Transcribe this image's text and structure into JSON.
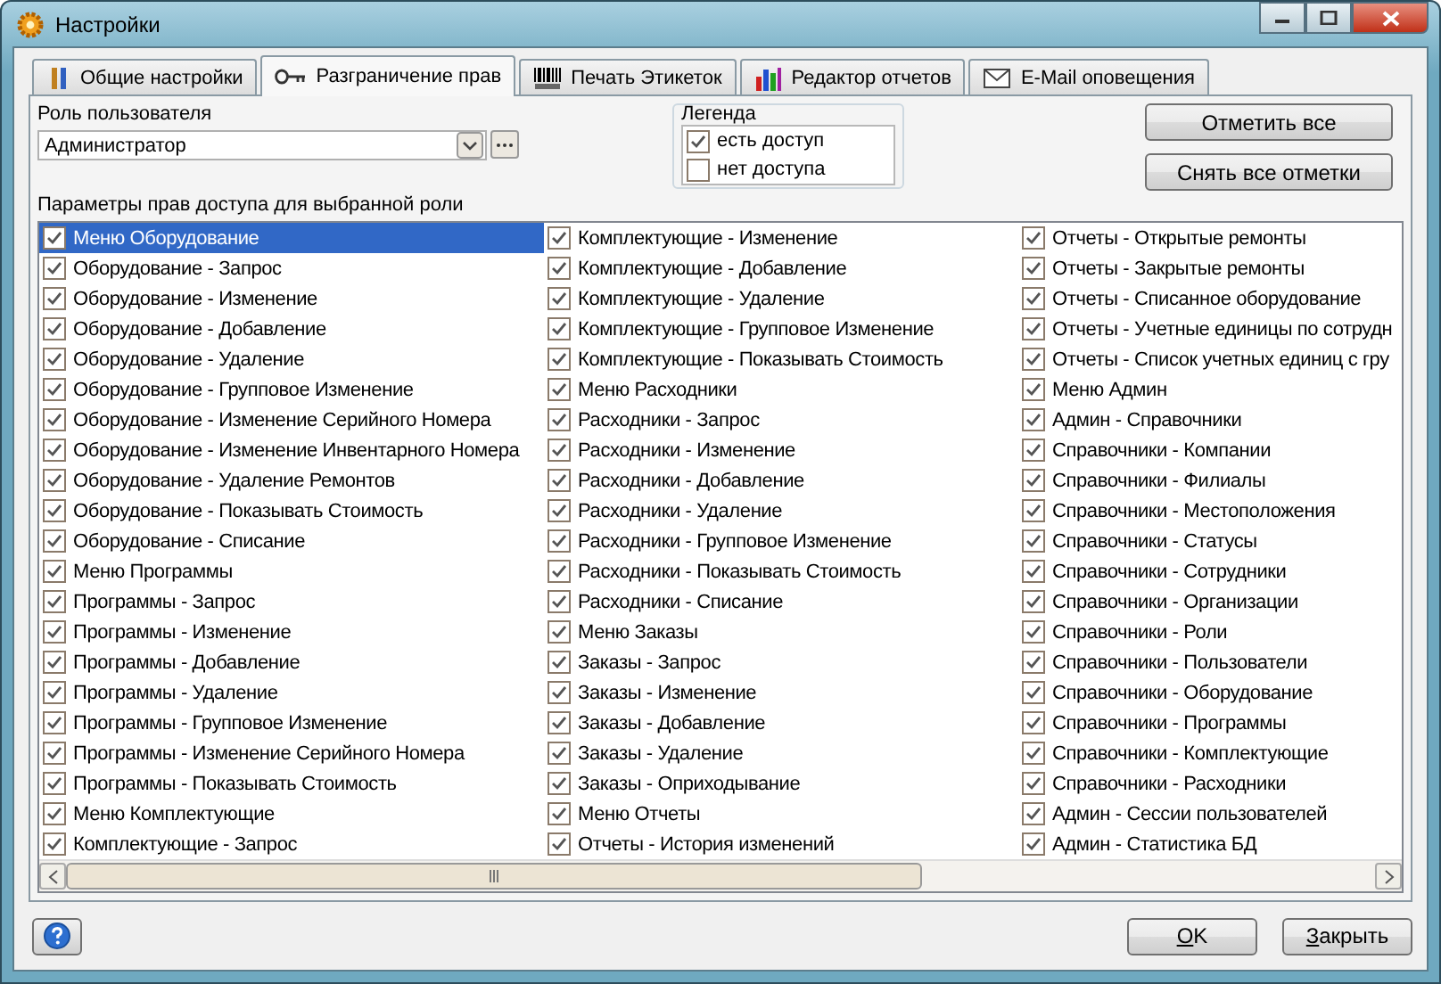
{
  "window": {
    "title": "Настройки"
  },
  "tabs": [
    {
      "label": "Общие настройки",
      "selected": false
    },
    {
      "label": "Разграничение прав",
      "selected": true
    },
    {
      "label": "Печать Этикеток",
      "selected": false
    },
    {
      "label": "Редактор отчетов",
      "selected": false
    },
    {
      "label": "E-Mail оповещения",
      "selected": false
    }
  ],
  "role": {
    "label": "Роль пользователя",
    "value": "Администратор"
  },
  "legend": {
    "title": "Легенда",
    "items": [
      {
        "label": "есть доступ",
        "checked": true
      },
      {
        "label": "нет доступа",
        "checked": false
      }
    ]
  },
  "side_buttons": [
    "Отметить все",
    "Снять все отметки"
  ],
  "permissions": {
    "label": "Параметры прав доступа для выбранной роли",
    "columns": [
      [
        {
          "label": "Меню Оборудование",
          "checked": true,
          "selected": true
        },
        {
          "label": "Оборудование - Запрос",
          "checked": true,
          "selected": false
        },
        {
          "label": "Оборудование - Изменение",
          "checked": true,
          "selected": false
        },
        {
          "label": "Оборудование - Добавление",
          "checked": true,
          "selected": false
        },
        {
          "label": "Оборудование - Удаление",
          "checked": true,
          "selected": false
        },
        {
          "label": "Оборудование - Групповое Изменение",
          "checked": true,
          "selected": false
        },
        {
          "label": "Оборудование - Изменение Серийного Номера",
          "checked": true,
          "selected": false
        },
        {
          "label": "Оборудование - Изменение Инвентарного Номера",
          "checked": true,
          "selected": false
        },
        {
          "label": "Оборудование - Удаление Ремонтов",
          "checked": true,
          "selected": false
        },
        {
          "label": "Оборудование - Показывать Стоимость",
          "checked": true,
          "selected": false
        },
        {
          "label": "Оборудование - Списание",
          "checked": true,
          "selected": false
        },
        {
          "label": "Меню Программы",
          "checked": true,
          "selected": false
        },
        {
          "label": "Программы - Запрос",
          "checked": true,
          "selected": false
        },
        {
          "label": "Программы - Изменение",
          "checked": true,
          "selected": false
        },
        {
          "label": "Программы - Добавление",
          "checked": true,
          "selected": false
        },
        {
          "label": "Программы - Удаление",
          "checked": true,
          "selected": false
        },
        {
          "label": "Программы - Групповое Изменение",
          "checked": true,
          "selected": false
        },
        {
          "label": "Программы - Изменение Серийного Номера",
          "checked": true,
          "selected": false
        },
        {
          "label": "Программы - Показывать Стоимость",
          "checked": true,
          "selected": false
        },
        {
          "label": "Меню Комплектующие",
          "checked": true,
          "selected": false
        },
        {
          "label": "Комплектующие - Запрос",
          "checked": true,
          "selected": false
        }
      ],
      [
        {
          "label": "Комплектующие - Изменение",
          "checked": true,
          "selected": false
        },
        {
          "label": "Комплектующие - Добавление",
          "checked": true,
          "selected": false
        },
        {
          "label": "Комплектующие - Удаление",
          "checked": true,
          "selected": false
        },
        {
          "label": "Комплектующие - Групповое Изменение",
          "checked": true,
          "selected": false
        },
        {
          "label": "Комплектующие - Показывать Стоимость",
          "checked": true,
          "selected": false
        },
        {
          "label": "Меню Расходники",
          "checked": true,
          "selected": false
        },
        {
          "label": "Расходники - Запрос",
          "checked": true,
          "selected": false
        },
        {
          "label": "Расходники - Изменение",
          "checked": true,
          "selected": false
        },
        {
          "label": "Расходники - Добавление",
          "checked": true,
          "selected": false
        },
        {
          "label": "Расходники - Удаление",
          "checked": true,
          "selected": false
        },
        {
          "label": "Расходники - Групповое Изменение",
          "checked": true,
          "selected": false
        },
        {
          "label": "Расходники - Показывать Стоимость",
          "checked": true,
          "selected": false
        },
        {
          "label": "Расходники - Списание",
          "checked": true,
          "selected": false
        },
        {
          "label": "Меню Заказы",
          "checked": true,
          "selected": false
        },
        {
          "label": "Заказы - Запрос",
          "checked": true,
          "selected": false
        },
        {
          "label": "Заказы - Изменение",
          "checked": true,
          "selected": false
        },
        {
          "label": "Заказы - Добавление",
          "checked": true,
          "selected": false
        },
        {
          "label": "Заказы - Удаление",
          "checked": true,
          "selected": false
        },
        {
          "label": "Заказы - Оприходывание",
          "checked": true,
          "selected": false
        },
        {
          "label": "Меню Отчеты",
          "checked": true,
          "selected": false
        },
        {
          "label": "Отчеты - История изменений",
          "checked": true,
          "selected": false
        }
      ],
      [
        {
          "label": "Отчеты - Открытые ремонты",
          "checked": true,
          "selected": false
        },
        {
          "label": "Отчеты - Закрытые ремонты",
          "checked": true,
          "selected": false
        },
        {
          "label": "Отчеты - Списанное оборудование",
          "checked": true,
          "selected": false
        },
        {
          "label": "Отчеты - Учетные единицы по сотрудн",
          "checked": true,
          "selected": false
        },
        {
          "label": "Отчеты - Список учетных единиц с гру",
          "checked": true,
          "selected": false
        },
        {
          "label": "Меню Админ",
          "checked": true,
          "selected": false
        },
        {
          "label": "Админ - Справочники",
          "checked": true,
          "selected": false
        },
        {
          "label": "Справочники - Компании",
          "checked": true,
          "selected": false
        },
        {
          "label": "Справочники - Филиалы",
          "checked": true,
          "selected": false
        },
        {
          "label": "Справочники - Местоположения",
          "checked": true,
          "selected": false
        },
        {
          "label": "Справочники - Статусы",
          "checked": true,
          "selected": false
        },
        {
          "label": "Справочники - Сотрудники",
          "checked": true,
          "selected": false
        },
        {
          "label": "Справочники - Организации",
          "checked": true,
          "selected": false
        },
        {
          "label": "Справочники - Роли",
          "checked": true,
          "selected": false
        },
        {
          "label": "Справочники - Пользователи",
          "checked": true,
          "selected": false
        },
        {
          "label": "Справочники - Оборудование",
          "checked": true,
          "selected": false
        },
        {
          "label": "Справочники - Программы",
          "checked": true,
          "selected": false
        },
        {
          "label": "Справочники - Комплектующие",
          "checked": true,
          "selected": false
        },
        {
          "label": "Справочники - Расходники",
          "checked": true,
          "selected": false
        },
        {
          "label": "Админ - Сессии пользователей",
          "checked": true,
          "selected": false
        },
        {
          "label": "Админ - Статистика БД",
          "checked": true,
          "selected": false
        }
      ]
    ]
  },
  "footer_buttons": [
    "OK",
    "Закрыть"
  ]
}
